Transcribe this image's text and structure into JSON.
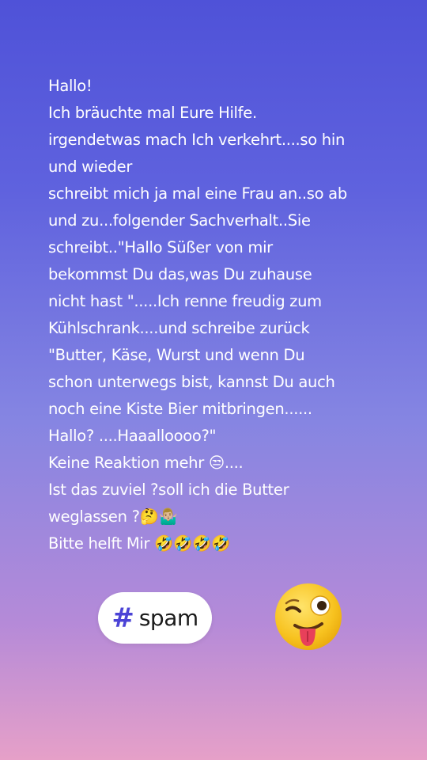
{
  "story": {
    "lines": [
      "Hallo!",
      "Ich bräuchte mal Eure Hilfe.",
      "irgendetwas mach Ich verkehrt....so hin",
      "und wieder",
      "schreibt mich ja mal eine Frau an..so ab",
      "und zu...folgender Sachverhalt..Sie",
      "schreibt..\"Hallo Süßer von mir",
      "bekommst Du das,was Du zuhause",
      "nicht hast \".....Ich renne freudig zum",
      "Kühlschrank....und schreibe zurück",
      "\"Butter, Käse, Wurst  und wenn Du",
      "schon unterwegs bist, kannst Du auch",
      "noch eine Kiste Bier  mitbringen......",
      "Hallo? ....Haaalloooo?\"",
      "Keine Reaktion mehr 😒....",
      "Ist das zuviel ?soll ich die Butter",
      "weglassen ?🤔🤷🏼‍♂️",
      "Bitte helft Mir 🤣🤣🤣🤣"
    ]
  },
  "hashtag": {
    "symbol": "#",
    "label": "spam"
  },
  "icons": {
    "wink_sticker": "winking-face-with-tongue-icon"
  },
  "colors": {
    "hash_accent": "#4b43d6",
    "emoji_yellow": "#f7c21f"
  }
}
